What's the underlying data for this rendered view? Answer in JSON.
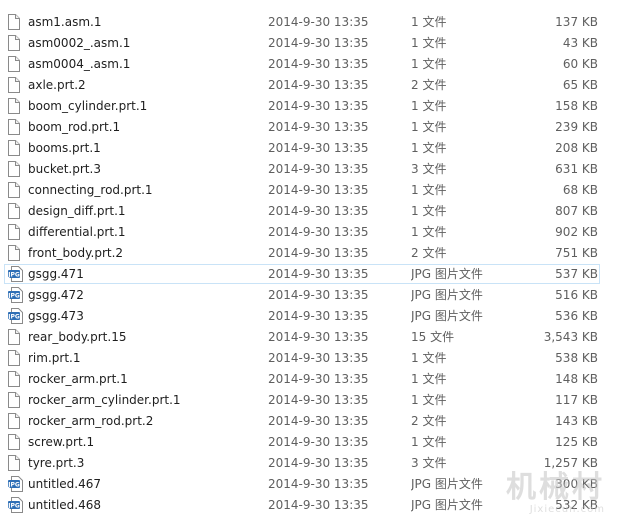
{
  "files": [
    {
      "name": "asm1.asm.1",
      "date": "2014-9-30 13:35",
      "type": "1 文件",
      "size": "137 KB",
      "icon": "blank-file-icon"
    },
    {
      "name": "asm0002_.asm.1",
      "date": "2014-9-30 13:35",
      "type": "1 文件",
      "size": "43 KB",
      "icon": "blank-file-icon"
    },
    {
      "name": "asm0004_.asm.1",
      "date": "2014-9-30 13:35",
      "type": "1 文件",
      "size": "60 KB",
      "icon": "blank-file-icon"
    },
    {
      "name": "axle.prt.2",
      "date": "2014-9-30 13:35",
      "type": "2 文件",
      "size": "65 KB",
      "icon": "blank-file-icon"
    },
    {
      "name": "boom_cylinder.prt.1",
      "date": "2014-9-30 13:35",
      "type": "1 文件",
      "size": "158 KB",
      "icon": "blank-file-icon"
    },
    {
      "name": "boom_rod.prt.1",
      "date": "2014-9-30 13:35",
      "type": "1 文件",
      "size": "239 KB",
      "icon": "blank-file-icon"
    },
    {
      "name": "booms.prt.1",
      "date": "2014-9-30 13:35",
      "type": "1 文件",
      "size": "208 KB",
      "icon": "blank-file-icon"
    },
    {
      "name": "bucket.prt.3",
      "date": "2014-9-30 13:35",
      "type": "3 文件",
      "size": "631 KB",
      "icon": "blank-file-icon"
    },
    {
      "name": "connecting_rod.prt.1",
      "date": "2014-9-30 13:35",
      "type": "1 文件",
      "size": "68 KB",
      "icon": "blank-file-icon"
    },
    {
      "name": "design_diff.prt.1",
      "date": "2014-9-30 13:35",
      "type": "1 文件",
      "size": "807 KB",
      "icon": "blank-file-icon"
    },
    {
      "name": "differential.prt.1",
      "date": "2014-9-30 13:35",
      "type": "1 文件",
      "size": "902 KB",
      "icon": "blank-file-icon"
    },
    {
      "name": "front_body.prt.2",
      "date": "2014-9-30 13:35",
      "type": "2 文件",
      "size": "751 KB",
      "icon": "blank-file-icon"
    },
    {
      "name": "gsgg.471",
      "date": "2014-9-30 13:35",
      "type": "JPG 图片文件",
      "size": "537 KB",
      "icon": "jpg-file-icon",
      "hover": true
    },
    {
      "name": "gsgg.472",
      "date": "2014-9-30 13:35",
      "type": "JPG 图片文件",
      "size": "516 KB",
      "icon": "jpg-file-icon"
    },
    {
      "name": "gsgg.473",
      "date": "2014-9-30 13:35",
      "type": "JPG 图片文件",
      "size": "536 KB",
      "icon": "jpg-file-icon"
    },
    {
      "name": "rear_body.prt.15",
      "date": "2014-9-30 13:35",
      "type": "15 文件",
      "size": "3,543 KB",
      "icon": "blank-file-icon"
    },
    {
      "name": "rim.prt.1",
      "date": "2014-9-30 13:35",
      "type": "1 文件",
      "size": "538 KB",
      "icon": "blank-file-icon"
    },
    {
      "name": "rocker_arm.prt.1",
      "date": "2014-9-30 13:35",
      "type": "1 文件",
      "size": "148 KB",
      "icon": "blank-file-icon"
    },
    {
      "name": "rocker_arm_cylinder.prt.1",
      "date": "2014-9-30 13:35",
      "type": "1 文件",
      "size": "117 KB",
      "icon": "blank-file-icon"
    },
    {
      "name": "rocker_arm_rod.prt.2",
      "date": "2014-9-30 13:35",
      "type": "2 文件",
      "size": "143 KB",
      "icon": "blank-file-icon"
    },
    {
      "name": "screw.prt.1",
      "date": "2014-9-30 13:35",
      "type": "1 文件",
      "size": "125 KB",
      "icon": "blank-file-icon"
    },
    {
      "name": "tyre.prt.3",
      "date": "2014-9-30 13:35",
      "type": "3 文件",
      "size": "1,257 KB",
      "icon": "blank-file-icon"
    },
    {
      "name": "untitled.467",
      "date": "2014-9-30 13:35",
      "type": "JPG 图片文件",
      "size": "300 KB",
      "icon": "jpg-file-icon"
    },
    {
      "name": "untitled.468",
      "date": "2014-9-30 13:35",
      "type": "JPG 图片文件",
      "size": "532 KB",
      "icon": "jpg-file-icon"
    }
  ],
  "icon_labels": {
    "jpg": "JPG"
  },
  "watermark": {
    "main": "机械村",
    "sub": "Jixiecun.com"
  },
  "colors": {
    "hover_border": "#c9e3f7",
    "jpg_icon": "#2f6fb6",
    "text": "#1e1e1e",
    "secondary_text": "#5f5f5f"
  }
}
